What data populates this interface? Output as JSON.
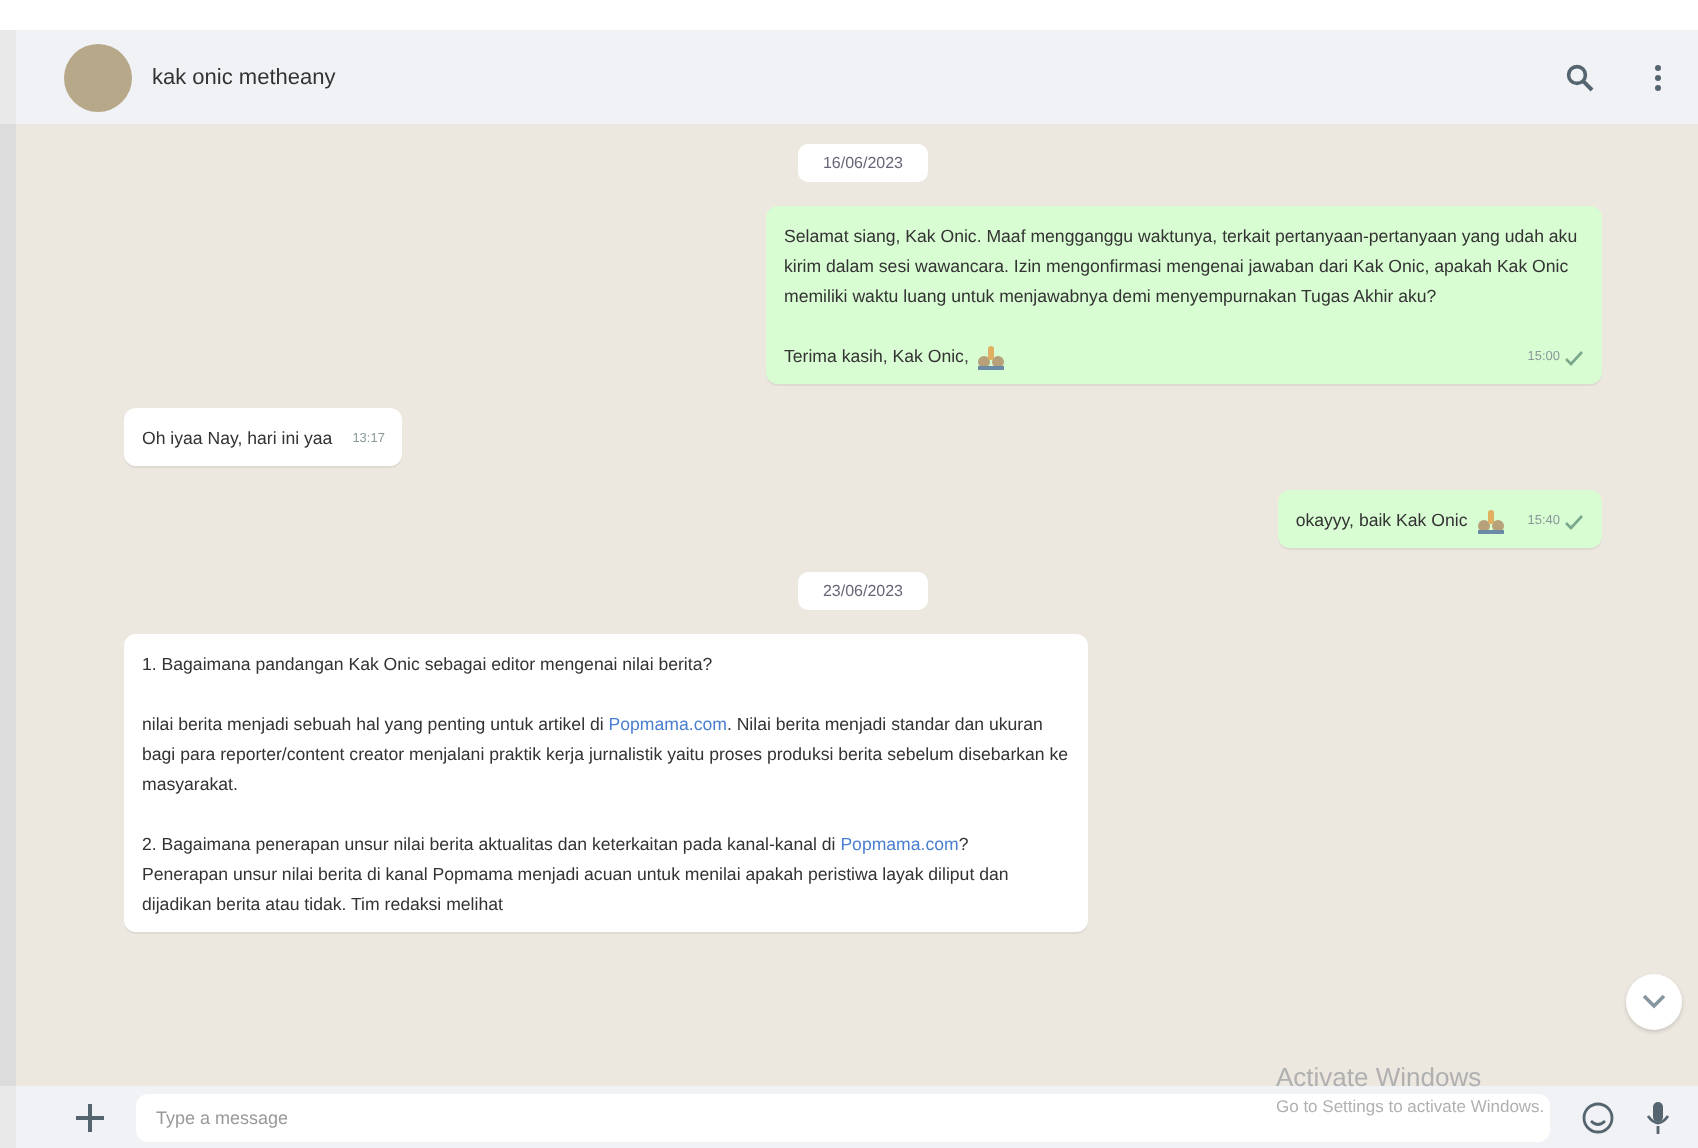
{
  "header": {
    "contact_name": "kak onic metheany"
  },
  "messages": [
    {
      "kind": "date",
      "text": "16/06/2023"
    },
    {
      "kind": "out",
      "paragraphs": [
        [
          {
            "text": "Selamat siang, Kak Onic. Maaf mengganggu waktunya, terkait pertanyaan-pertanyaan yang udah aku kirim dalam sesi wawancara. Izin mengonfirmasi mengenai jawaban dari Kak Onic, apakah Kak Onic memiliki waktu luang untuk menjawabnya demi menyempurnakan Tugas Akhir aku?",
            "kind": "text"
          }
        ],
        [
          {
            "text": "Terima kasih, Kak Onic,",
            "kind": "text"
          }
        ]
      ],
      "emoji": true,
      "time": "15:00"
    },
    {
      "kind": "in",
      "paragraphs": [
        [
          {
            "text": "Oh iyaa Nay, hari ini yaa",
            "kind": "text"
          }
        ]
      ],
      "emoji": false,
      "time": "13:17"
    },
    {
      "kind": "out",
      "paragraphs": [
        [
          {
            "text": "okayyy, baik Kak Onic",
            "kind": "text"
          }
        ]
      ],
      "emoji": true,
      "time": "15:40"
    },
    {
      "kind": "date",
      "text": "23/06/2023"
    },
    {
      "kind": "in",
      "paragraphs": [
        [
          {
            "text": "1. Bagaimana pandangan Kak Onic sebagai editor mengenai nilai berita?",
            "kind": "text"
          }
        ],
        [
          {
            "text": "nilai berita menjadi sebuah hal yang penting untuk artikel di ",
            "kind": "text"
          },
          {
            "text": "Popmama.com",
            "kind": "link"
          },
          {
            "text": ". Nilai berita menjadi standar dan ukuran bagi para reporter/content creator menjalani praktik kerja jurnalistik yaitu proses produksi berita sebelum disebarkan ke masyarakat.",
            "kind": "text"
          }
        ],
        [
          {
            "text": "2. Bagaimana penerapan unsur nilai berita aktualitas dan keterkaitan pada kanal-kanal di ",
            "kind": "text"
          },
          {
            "text": "Popmama.com",
            "kind": "link"
          },
          {
            "text": "?",
            "kind": "text"
          }
        ],
        [
          {
            "text": "Penerapan unsur nilai berita di kanal Popmama menjadi acuan untuk menilai apakah peristiwa layak diliput dan dijadikan berita atau tidak. Tim redaksi melihat",
            "kind": "text"
          }
        ]
      ],
      "emoji": false
    }
  ],
  "composer": {
    "placeholder": "Type a message"
  },
  "os_notice": {
    "title": "Activate Windows",
    "subtitle": "Go to Settings to activate Windows."
  }
}
